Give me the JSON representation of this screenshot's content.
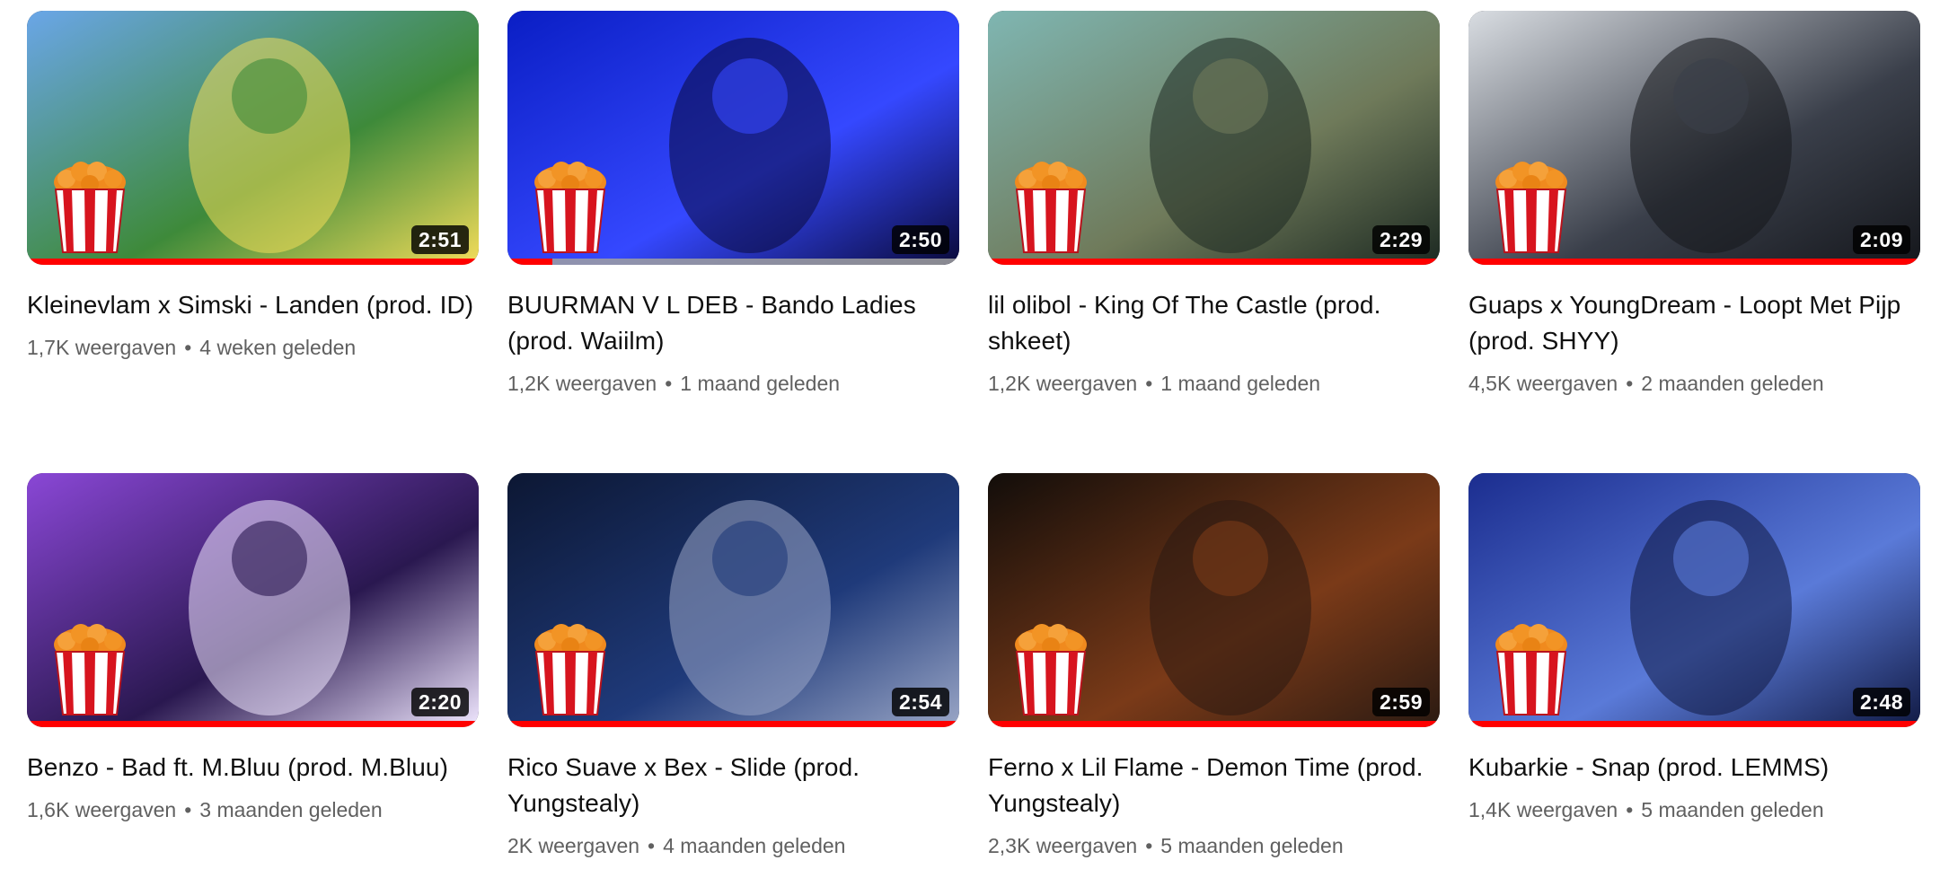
{
  "videos": [
    {
      "title": "Kleinevlam x Simski - Landen (prod. ID)",
      "views": "1,7K weergaven",
      "age": "4 weken geleden",
      "duration": "2:51",
      "progress": 1.0,
      "colors": [
        "#6aa6e8",
        "#3e8a3a",
        "#f3dc5a"
      ]
    },
    {
      "title": "BUURMAN V L DEB - Bando Ladies (prod. Waiilm)",
      "views": "1,2K weergaven",
      "age": "1 maand geleden",
      "duration": "2:50",
      "progress": 0.1,
      "colors": [
        "#0a1ec4",
        "#3548ff",
        "#0a0a3a"
      ]
    },
    {
      "title": "lil olibol - King Of The Castle (prod. shkeet)",
      "views": "1,2K weergaven",
      "age": "1 maand geleden",
      "duration": "2:29",
      "progress": 1.0,
      "colors": [
        "#7fb6b2",
        "#6f7a5a",
        "#1d2a22"
      ]
    },
    {
      "title": "Guaps x YoungDream - Loopt Met Pijp (prod. SHYY)",
      "views": "4,5K weergaven",
      "age": "2 maanden geleden",
      "duration": "2:09",
      "progress": 1.0,
      "colors": [
        "#d9dde2",
        "#3a3f4a",
        "#15171c"
      ]
    },
    {
      "title": "Benzo - Bad ft. M.Bluu (prod. M.Bluu)",
      "views": "1,6K weergaven",
      "age": "3 maanden geleden",
      "duration": "2:20",
      "progress": 1.0,
      "colors": [
        "#8a47d6",
        "#2a1850",
        "#f0e7ff"
      ]
    },
    {
      "title": "Rico Suave x Bex - Slide (prod. Yungstealy)",
      "views": "2K weergaven",
      "age": "4 maanden geleden",
      "duration": "2:54",
      "progress": 1.0,
      "colors": [
        "#0c1733",
        "#1f3a7a",
        "#9aa6c6"
      ]
    },
    {
      "title": "Ferno x Lil Flame - Demon Time (prod. Yungstealy)",
      "views": "2,3K weergaven",
      "age": "5 maanden geleden",
      "duration": "2:59",
      "progress": 1.0,
      "colors": [
        "#120d0a",
        "#7a3a18",
        "#2b1a12"
      ]
    },
    {
      "title": "Kubarkie - Snap (prod. LEMMS)",
      "views": "1,4K weergaven",
      "age": "5 maanden geleden",
      "duration": "2:48",
      "progress": 1.0,
      "colors": [
        "#1b2d8f",
        "#5a7ad8",
        "#111a44"
      ]
    }
  ]
}
